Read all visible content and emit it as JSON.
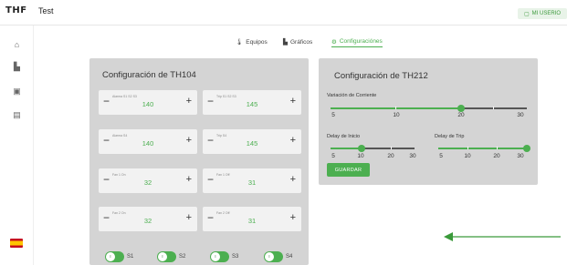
{
  "header": {
    "logo": "THF",
    "title": "Test",
    "user_button": "MI USERIO"
  },
  "sidebar": {
    "items": [
      "home-icon",
      "device-icon",
      "monitor-icon",
      "list-icon"
    ],
    "language_flag": "es"
  },
  "tabs": [
    {
      "label": "Equipos",
      "icon": "thermometer-icon"
    },
    {
      "label": "Gráficos",
      "icon": "chart-icon"
    },
    {
      "label": "Configuraciónes",
      "icon": "settings-icon",
      "active": true
    }
  ],
  "left_card": {
    "title": "Configuración de TH104",
    "steppers": [
      {
        "label": "Alarma S1 S2 S3",
        "value": "140"
      },
      {
        "label": "Trip S1 S2 S3",
        "value": "145"
      },
      {
        "label": "Alarma S4",
        "value": "140"
      },
      {
        "label": "Trip S4",
        "value": "145"
      },
      {
        "label": "Fan 1 On",
        "value": "32"
      },
      {
        "label": "Fan 1 Off",
        "value": "31"
      },
      {
        "label": "Fan 2 On",
        "value": "32"
      },
      {
        "label": "Fan 2 Off",
        "value": "31"
      }
    ],
    "toggles": [
      {
        "label": "S1",
        "on": true
      },
      {
        "label": "S2",
        "on": true
      },
      {
        "label": "S3",
        "on": true
      },
      {
        "label": "S4",
        "on": true
      }
    ]
  },
  "right_card": {
    "title": "Configuración de TH212",
    "corriente": {
      "label": "Variación de Corriente",
      "ticks": [
        "5",
        "10",
        "20",
        "30"
      ],
      "value": "20"
    },
    "delay_inicio": {
      "label": "Delay de Inicio",
      "ticks": [
        "5",
        "10",
        "20",
        "30"
      ],
      "value": "10"
    },
    "delay_trip": {
      "label": "Delay de Trip",
      "ticks": [
        "5",
        "10",
        "20",
        "30"
      ],
      "value": "30"
    },
    "save_label": "GUARDAR"
  },
  "colors": {
    "accent": "#4caf50",
    "card": "#d4d4d4",
    "arrow": "#3a9a3a"
  }
}
